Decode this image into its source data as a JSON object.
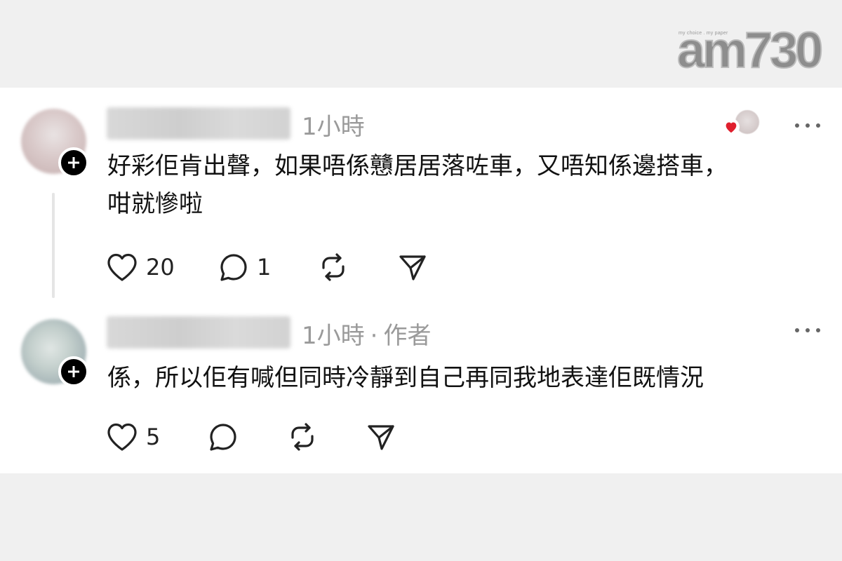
{
  "branding": {
    "logo_text": "am730",
    "tagline": "my choice . my paper"
  },
  "comments": [
    {
      "username": "",
      "time": "1小時",
      "author_tag": "",
      "text_line1": "好彩佢肯出聲，如果唔係戇居居落咗車，又唔知係邊搭車，",
      "text_line2": "咁就慘啦",
      "likes": "20",
      "replies": "1",
      "liked_by_author": true
    },
    {
      "username": "",
      "time": "1小時",
      "separator": "·",
      "author_tag": "作者",
      "text_line1": "係，所以佢有喊但同時冷靜到自己再同我地表達佢既情況",
      "likes": "5",
      "replies": ""
    }
  ],
  "icons": {
    "like": "heart-icon",
    "reply": "comment-icon",
    "repost": "repost-icon",
    "share": "send-icon",
    "more": "more-icon",
    "follow": "plus-icon"
  },
  "colors": {
    "heart_red": "#e0202e",
    "muted_text": "#9a9a9a",
    "body_text": "#111111"
  }
}
